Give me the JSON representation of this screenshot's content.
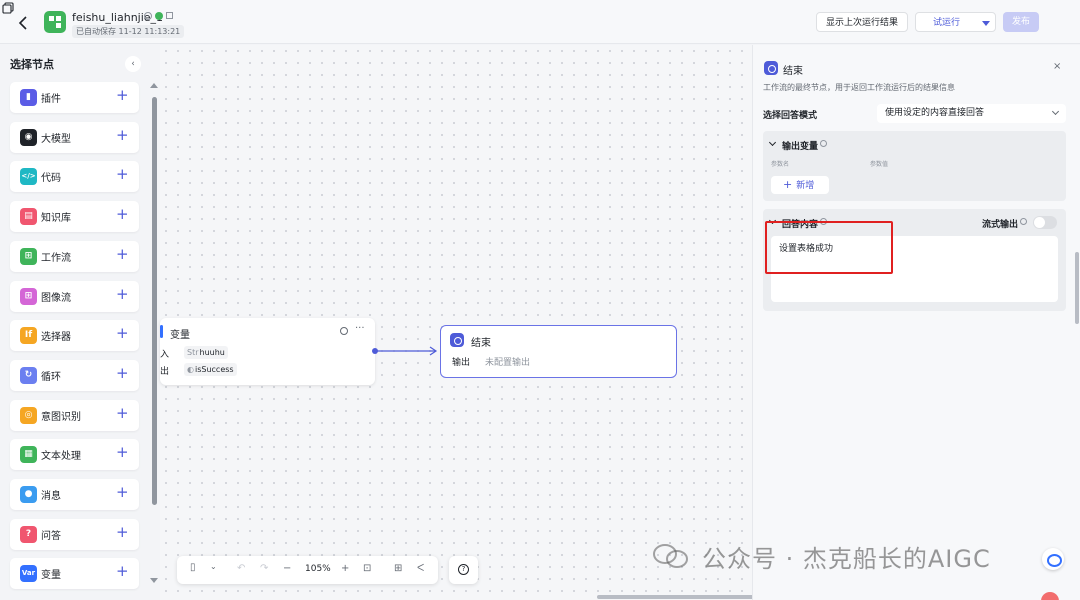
{
  "header": {
    "app_name": "feishu_liahnjie_1",
    "saved_status": "已自动保存 11-12 11:13:21",
    "show_last_run_label": "显示上次运行结果",
    "trial_run_label": "试运行",
    "publish_label": "发布"
  },
  "sidebar": {
    "title": "选择节点",
    "collapse_glyph": "‹",
    "add_glyph": "+",
    "items": [
      {
        "label": "插件",
        "icon": "plugin-icon",
        "color": "#5b5ce6",
        "glyph": "▮"
      },
      {
        "label": "大模型",
        "icon": "llm-icon",
        "color": "#1f2329",
        "glyph": "◉"
      },
      {
        "label": "代码",
        "icon": "code-icon",
        "color": "#1fb8c4",
        "glyph": "</>"
      },
      {
        "label": "知识库",
        "icon": "knowledge-icon",
        "color": "#f0566f",
        "glyph": "▤"
      },
      {
        "label": "工作流",
        "icon": "workflow-icon",
        "color": "#3fb45a",
        "glyph": "⊞"
      },
      {
        "label": "图像流",
        "icon": "imageflow-icon",
        "color": "#d466d6",
        "glyph": "⊞"
      },
      {
        "label": "选择器",
        "icon": "selector-icon",
        "color": "#f5a623",
        "glyph": "If"
      },
      {
        "label": "循环",
        "icon": "loop-icon",
        "color": "#6b7ff0",
        "glyph": "↻"
      },
      {
        "label": "意图识别",
        "icon": "intent-icon",
        "color": "#f5a623",
        "glyph": "◎"
      },
      {
        "label": "文本处理",
        "icon": "text-process-icon",
        "color": "#3fb45a",
        "glyph": "▦"
      },
      {
        "label": "消息",
        "icon": "message-icon",
        "color": "#3b9cf0",
        "glyph": "●"
      },
      {
        "label": "问答",
        "icon": "qa-icon",
        "color": "#f0566f",
        "glyph": "?"
      },
      {
        "label": "变量",
        "icon": "variable-icon",
        "color": "#3370ff",
        "glyph": "Var"
      }
    ]
  },
  "canvas": {
    "var_node": {
      "title": "变量",
      "in_label": "入",
      "in_type": "Str",
      "in_value": "huuhu",
      "out_label": "出",
      "out_value": "isSuccess",
      "more_glyph": "···"
    },
    "end_node": {
      "title": "结束",
      "output_label": "输出",
      "output_value": "未配置输出"
    },
    "toolbar": {
      "zoom": "105%",
      "minus": "−",
      "plus": "+",
      "undo": "↶",
      "redo": "↷",
      "fit": "⊡",
      "layout": "⊞",
      "collapse": "ᐸ",
      "help": "?"
    }
  },
  "panel": {
    "title": "结束",
    "close_glyph": "×",
    "description": "工作流的最终节点，用于返回工作流运行后的结果信息",
    "mode_label": "选择回答模式",
    "mode_value": "使用设定的内容直接回答",
    "output_section": {
      "title": "输出变量",
      "col_name": "参数名",
      "col_value": "参数值",
      "add_label": "新增"
    },
    "answer_section": {
      "title": "回答内容",
      "stream_label": "流式输出",
      "content": "设置表格成功"
    }
  },
  "watermark": "公众号 · 杰克船长的AIGC",
  "colors": {
    "accent": "#4e5bd8",
    "highlight": "#e02020",
    "publish_disabled": "#c7cbf5"
  }
}
